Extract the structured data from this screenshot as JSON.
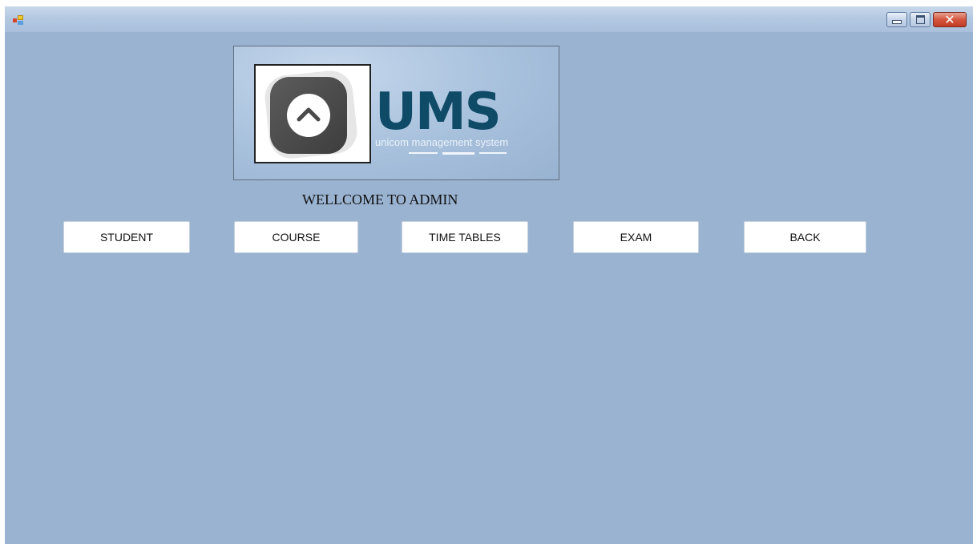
{
  "window": {
    "app_icon": "app-icon",
    "controls": {
      "minimize_icon": "minimize-icon",
      "maximize_icon": "maximize-icon",
      "close_icon": "close-icon"
    }
  },
  "logo": {
    "title": "UMS",
    "subtitle": "unicom management system",
    "icon": "chevron-up-icon"
  },
  "welcome_text": "WELLCOME TO ADMIN",
  "buttons": {
    "student": "STUDENT",
    "course": "COURSE",
    "time_tables": "TIME TABLES",
    "exam": "EXAM",
    "back": "BACK"
  },
  "colors": {
    "background": "#9ab3d1",
    "logo_text": "#0f4a66",
    "close_button": "#c94a33"
  }
}
